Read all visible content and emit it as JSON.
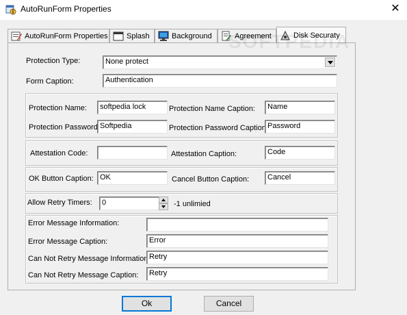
{
  "window": {
    "title": "AutoRunForm Properties",
    "close_glyph": "✕"
  },
  "tabs": [
    {
      "label": "AutoRunForm Properties",
      "icon": "form-properties-icon"
    },
    {
      "label": "Splash",
      "icon": "splash-window-icon"
    },
    {
      "label": "Background",
      "icon": "monitor-icon"
    },
    {
      "label": "Agreement",
      "icon": "agreement-icon"
    },
    {
      "label": "Disk Securaty",
      "icon": "disk-security-icon",
      "active": true
    }
  ],
  "watermark": "SOFTPEDIA",
  "form": {
    "protection_type": {
      "label": "Protection Type:",
      "value": "None protect"
    },
    "form_caption": {
      "label": "Form Caption:",
      "value": "Authentication"
    },
    "protection_name": {
      "label": "Protection Name:",
      "value": "softpedia lock"
    },
    "protection_name_caption": {
      "label": "Protection Name Caption:",
      "value": "Name"
    },
    "protection_password": {
      "label": "Protection Password:",
      "value": "Softpedia"
    },
    "protection_password_caption": {
      "label": "Protection Password Caption:",
      "value": "Password"
    },
    "attestation_code": {
      "label": "Attestation Code:",
      "value": ""
    },
    "attestation_caption": {
      "label": "Attestation Caption:",
      "value": "Code"
    },
    "ok_button_caption": {
      "label": "OK Button Caption:",
      "value": "OK"
    },
    "cancel_button_caption": {
      "label": "Cancel Button Caption:",
      "value": "Cancel"
    },
    "allow_retry_timers": {
      "label": "Allow Retry Timers:",
      "value": "0",
      "hint": "-1 unlimied"
    },
    "error_message_information": {
      "label": "Error Message Information:",
      "value": ""
    },
    "error_message_caption": {
      "label": "Error Message Caption:",
      "value": "Error"
    },
    "cannot_retry_information": {
      "label": "Can Not Retry Message Information:",
      "value": "Retry"
    },
    "cannot_retry_caption": {
      "label": "Can Not Retry Message Caption:",
      "value": "Retry"
    }
  },
  "buttons": {
    "ok": "Ok",
    "cancel": "Cancel"
  }
}
